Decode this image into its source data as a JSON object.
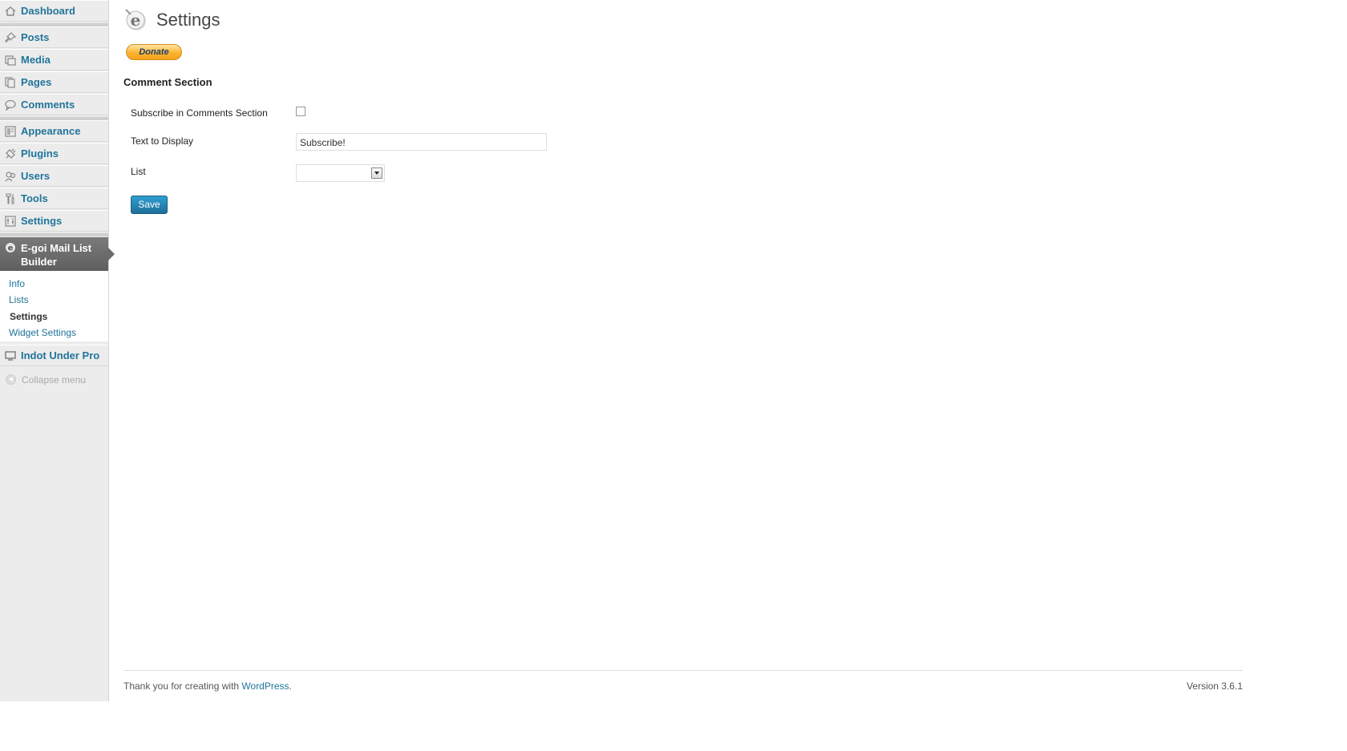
{
  "sidebar": {
    "items": [
      {
        "id": "dashboard",
        "label": "Dashboard",
        "icon": "dashboard-icon"
      },
      {
        "id": "posts",
        "label": "Posts",
        "icon": "pushpin-icon"
      },
      {
        "id": "media",
        "label": "Media",
        "icon": "media-icon"
      },
      {
        "id": "pages",
        "label": "Pages",
        "icon": "pages-icon"
      },
      {
        "id": "comments",
        "label": "Comments",
        "icon": "comment-bubble-icon"
      },
      {
        "id": "appearance",
        "label": "Appearance",
        "icon": "appearance-icon"
      },
      {
        "id": "plugins",
        "label": "Plugins",
        "icon": "plug-icon"
      },
      {
        "id": "users",
        "label": "Users",
        "icon": "users-icon"
      },
      {
        "id": "tools",
        "label": "Tools",
        "icon": "tools-icon"
      },
      {
        "id": "settings",
        "label": "Settings",
        "icon": "settings-icon"
      }
    ],
    "active_plugin": {
      "label": "E-goi Mail List Builder",
      "icon": "egoi-icon"
    },
    "submenu": [
      {
        "label": "Info"
      },
      {
        "label": "Lists"
      },
      {
        "label": "Settings",
        "current": true
      },
      {
        "label": "Widget Settings"
      }
    ],
    "extra_item": {
      "label": "Indot Under Pro",
      "icon": "monitor-icon"
    },
    "collapse_label": "Collapse menu"
  },
  "header": {
    "title": "Settings",
    "logo_icon": "egoi-logo-icon",
    "donate_label": "Donate"
  },
  "form": {
    "section_title": "Comment Section",
    "subscribe_label": "Subscribe in Comments Section",
    "subscribe_checked": false,
    "text_label": "Text to Display",
    "text_value": "Subscribe!",
    "list_label": "List",
    "list_value": "",
    "save_label": "Save"
  },
  "footer": {
    "thanks_prefix": "Thank you for creating with ",
    "wp_link": "WordPress",
    "thanks_suffix": ".",
    "version": "Version 3.6.1"
  },
  "colors": {
    "link": "#21759b",
    "save_button": "#21759b",
    "active_menu_bg": "#6d6d6d",
    "donate": "#fbb431"
  }
}
